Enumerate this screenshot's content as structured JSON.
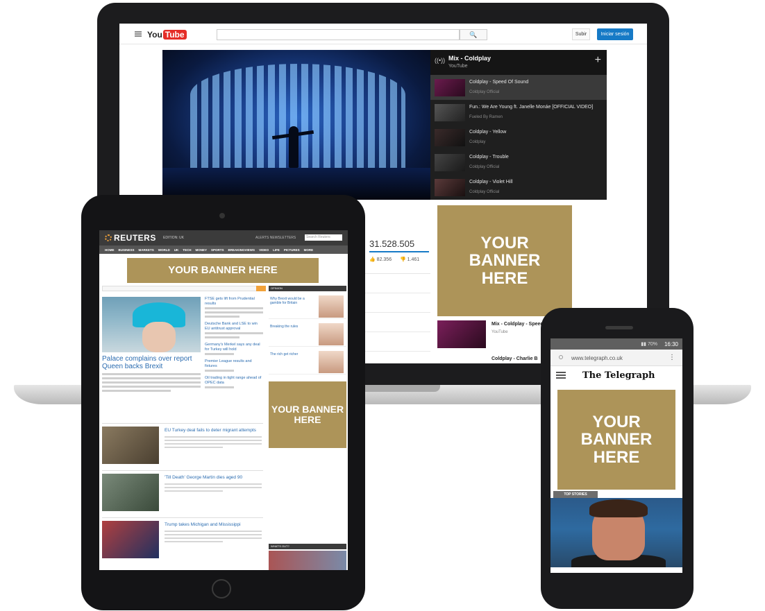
{
  "laptop": {
    "youtube": {
      "logo_you": "You",
      "logo_tube": "Tube",
      "search_icon": "search-icon",
      "upload_label": "Subir",
      "signin_label": "Iniciar sesión",
      "playlist": {
        "title": "Mix - Coldplay",
        "subtitle": "YouTube",
        "items": [
          {
            "title": "Coldplay - Speed Of Sound",
            "channel": "Coldplay Official"
          },
          {
            "title": "Fun.: We Are Young ft. Janelle Monáe [OFFICIAL VIDEO]",
            "channel": "Fueled By Ramen"
          },
          {
            "title": "Coldplay - Yellow",
            "channel": "Coldplay"
          },
          {
            "title": "Coldplay - Trouble",
            "channel": "Coldplay Official"
          },
          {
            "title": "Coldplay - Violet Hill",
            "channel": "Coldplay Official"
          }
        ]
      },
      "view_count": "31.528.505",
      "likes": "82.356",
      "dislikes": "1.461",
      "related": {
        "title": "Mix - Coldplay - Speed",
        "channel": "YouTube"
      },
      "related_next": "Coldplay - Charlie B"
    },
    "banner_text": "YOUR BANNER HERE"
  },
  "tablet": {
    "reuters": {
      "logo": "REUTERS",
      "edition": "EDITION: UK",
      "links": "ALERTS  NEWSLETTERS",
      "search_placeholder": "Search Reuters",
      "nav": [
        "HOME",
        "BUSINESS",
        "MARKETS",
        "WORLD",
        "UK",
        "TECH",
        "MONEY",
        "SPORTS",
        "BREAKINGVIEWS",
        "VIDEO",
        "LIFE",
        "PICTURES",
        "MORE"
      ],
      "banner_text": "YOUR BANNER HERE",
      "hero_title": "Palace complains over report Queen backs Brexit",
      "mid_stories": [
        "FTSE gets lift from Prudential results",
        "Deutsche Bank and LSE to win EU antitrust approval",
        "Germany's Merkel says any deal for Turkey will hold",
        "Premier League results and fixtures",
        "Oil trading in tight range ahead of OPEC data"
      ],
      "side_head": "OPINION",
      "side_items": [
        "Why Brexit would be a gamble for Britain",
        "Breaking the rules",
        "The rich get richer"
      ],
      "side_banner_text": "YOUR BANNER HERE",
      "stories": [
        "EU Turkey deal fails to deter migrant attempts",
        "'Till Death' George Martin dies aged 90",
        "Trump takes Michigan and Mississippi"
      ],
      "whatout": "WHAT'S OUT?"
    }
  },
  "phone": {
    "time": "16:30",
    "status_icons": "▮▮ 70%",
    "url": "www.telegraph.co.uk",
    "masthead": "The Telegraph",
    "banner_text": "YOUR BANNER HERE",
    "tag": "TOP STORIES"
  },
  "colors": {
    "banner_gold": "#ad9459",
    "youtube_red": "#e52d27",
    "youtube_blue": "#167ac6",
    "reuters_orange": "#f2a23a"
  }
}
